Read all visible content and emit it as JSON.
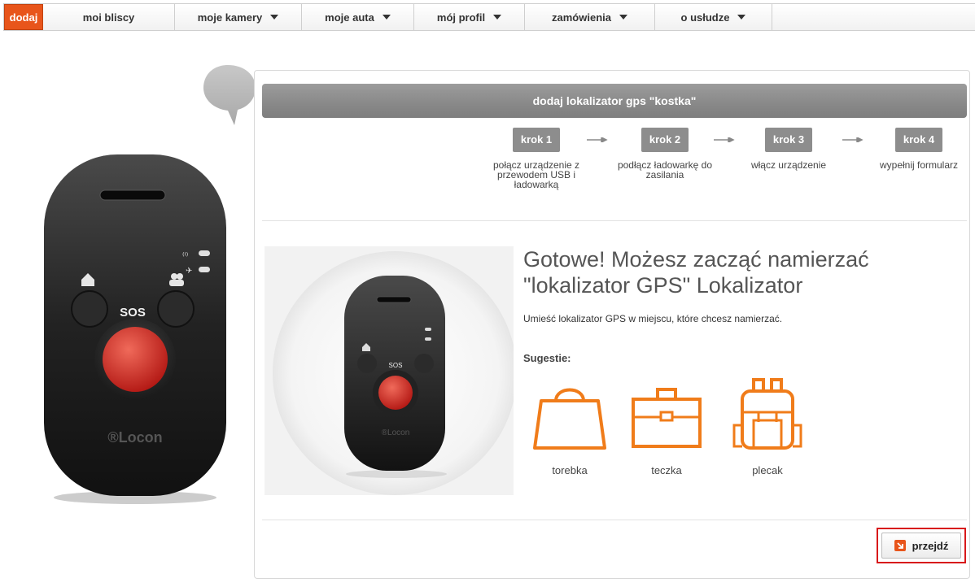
{
  "nav": {
    "items": [
      {
        "label": "dodaj",
        "active": true,
        "dropdown": false
      },
      {
        "label": "moi bliscy",
        "active": false,
        "dropdown": false
      },
      {
        "label": "moje kamery",
        "active": false,
        "dropdown": true
      },
      {
        "label": "moje auta",
        "active": false,
        "dropdown": true
      },
      {
        "label": "mój profil",
        "active": false,
        "dropdown": true
      },
      {
        "label": "zamówienia",
        "active": false,
        "dropdown": true
      },
      {
        "label": "o usłudze",
        "active": false,
        "dropdown": true
      }
    ]
  },
  "device": {
    "brand": "®Locon",
    "sos_label": "SOS"
  },
  "panel": {
    "title": "dodaj lokalizator gps \"kostka\"",
    "steps": [
      {
        "badge": "krok 1",
        "text": "połącz urządzenie z przewodem USB i ładowarką"
      },
      {
        "badge": "krok 2",
        "text": "podłącz ładowarkę do zasilania"
      },
      {
        "badge": "krok 3",
        "text": "włącz urządzenie"
      },
      {
        "badge": "krok 4",
        "text": "wypełnij formularz"
      }
    ],
    "ready_title": "Gotowe! Możesz zacząć namierzać \"lokalizator GPS\" Lokalizator",
    "ready_desc": "Umieść lokalizator GPS w miejscu, które chcesz namierzać.",
    "suggestions_title": "Sugestie:",
    "suggestions": [
      {
        "label": "torebka",
        "icon": "bag-icon"
      },
      {
        "label": "teczka",
        "icon": "briefcase-icon"
      },
      {
        "label": "plecak",
        "icon": "backpack-icon"
      }
    ],
    "next_button": "przejdź"
  },
  "colors": {
    "accent": "#e8551b",
    "header_gray": "#8d8d8d",
    "highlight_red": "#d8191b",
    "sos_red": "#d8251f"
  }
}
